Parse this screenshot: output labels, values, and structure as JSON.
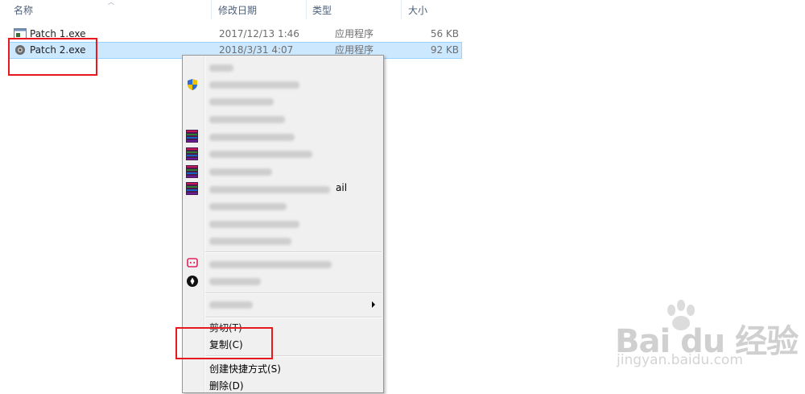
{
  "columns": {
    "name": "名称",
    "modified": "修改日期",
    "type": "类型",
    "size": "大小"
  },
  "files": [
    {
      "name": "Patch 1.exe",
      "modified": "2017/12/13 1:46",
      "type": "应用程序",
      "size": "56 KB",
      "icon": "application-window-icon"
    },
    {
      "name": "Patch 2.exe",
      "modified": "2018/3/31 4:07",
      "type": "应用程序",
      "size": "92 KB",
      "icon": "patch-gear-icon",
      "selected": true
    }
  ],
  "context_menu": {
    "partial_tail": "ail",
    "cut": "剪切(T)",
    "copy": "复制(C)",
    "create_shortcut": "创建快捷方式(S)",
    "delete": "删除(D)"
  },
  "watermark": {
    "logo": "Bai du 经验",
    "url": "jingyan.baidu.com"
  },
  "colors": {
    "selection_bg": "#cce8ff",
    "selection_border": "#99d1ff",
    "highlight_red": "#e8191e",
    "header_text": "#4c607a"
  }
}
